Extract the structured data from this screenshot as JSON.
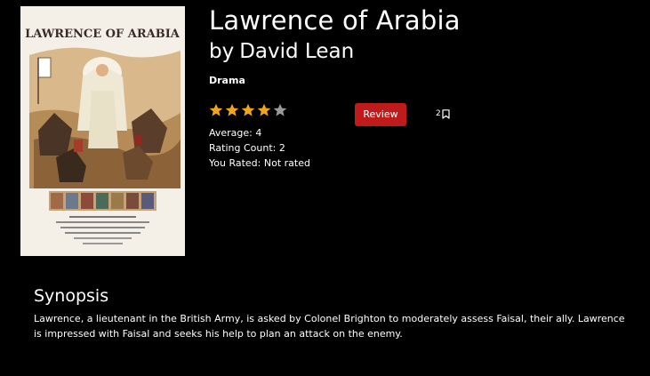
{
  "movie": {
    "title": "Lawrence of Arabia",
    "director_prefix": "by",
    "director": "David Lean",
    "genre": "Drama",
    "rating": 4,
    "max_rating": 5
  },
  "poster": {
    "title_text": "LAWRENCE OF ARABIA",
    "image_name": "movie-poster-lawrence-of-arabia"
  },
  "actions": {
    "review_label": "Review",
    "bookmark_count": "2"
  },
  "stats": {
    "average": "Average: 4",
    "rating_count": "Rating Count: 2",
    "you_rated": "You Rated: Not rated"
  },
  "synopsis": {
    "heading": "Synopsis",
    "text": "Lawrence, a lieutenant in the British Army, is asked by Colonel Brighton to moderately assess Faisal, their ally. Lawrence is impressed with Faisal and seeks his help to plan an attack on the enemy."
  },
  "colors": {
    "background": "#000000",
    "review_button": "#c01b1b",
    "star_filled": "#f2a51b",
    "star_empty": "#9a9a9a"
  },
  "icons": [
    "star-icon",
    "bookmark-icon"
  ]
}
